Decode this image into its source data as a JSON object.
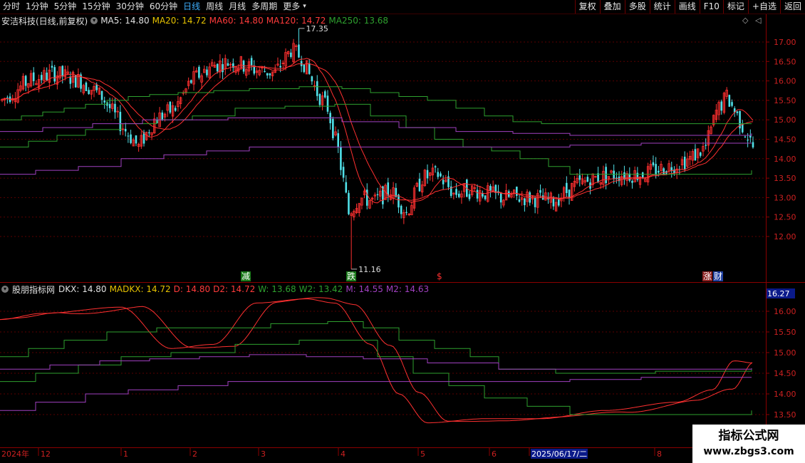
{
  "toolbar": {
    "left": [
      {
        "label": "分时",
        "active": false
      },
      {
        "label": "1分钟",
        "active": false
      },
      {
        "label": "5分钟",
        "active": false
      },
      {
        "label": "15分钟",
        "active": false
      },
      {
        "label": "30分钟",
        "active": false
      },
      {
        "label": "60分钟",
        "active": false
      },
      {
        "label": "日线",
        "active": true
      },
      {
        "label": "周线",
        "active": false
      },
      {
        "label": "月线",
        "active": false
      },
      {
        "label": "多周期",
        "active": false
      },
      {
        "label": "更多",
        "active": false
      }
    ],
    "more_arrow": "▾",
    "right": [
      "复权",
      "叠加",
      "多股",
      "统计",
      "画线",
      "F10",
      "标记",
      "+自选",
      "返回"
    ]
  },
  "main_info": {
    "stock": "安洁科技(日线,前复权)",
    "items": [
      {
        "text": "MA5: 14.80",
        "color": "#e0e0e0"
      },
      {
        "text": "MA20: 14.72",
        "color": "#e6c200"
      },
      {
        "text": "MA60: 14.80",
        "color": "#ff3b3b"
      },
      {
        "text": "MA120: 14.72",
        "color": "#ff3b3b"
      },
      {
        "text": "MA250: 13.68",
        "color": "#2ea02e"
      }
    ]
  },
  "sub_info": {
    "name": "股朋指标网",
    "items": [
      {
        "text": "DKX: 14.80",
        "color": "#e0e0e0"
      },
      {
        "text": "MADKX: 14.72",
        "color": "#e6c200"
      },
      {
        "text": "D: 14.80",
        "color": "#ff3b3b"
      },
      {
        "text": "D2: 14.72",
        "color": "#ff3b3b"
      },
      {
        "text": "W: 13.68",
        "color": "#2ea02e"
      },
      {
        "text": "W2: 13.42",
        "color": "#2ea02e"
      },
      {
        "text": "M: 14.55",
        "color": "#a040c0"
      },
      {
        "text": "M2: 14.63",
        "color": "#a040c0"
      }
    ]
  },
  "main_axis": [
    "17.00",
    "16.50",
    "16.00",
    "15.50",
    "15.00",
    "14.50",
    "14.00",
    "13.50",
    "13.00",
    "12.50",
    "12.00"
  ],
  "sub_axis": [
    "16.00",
    "15.50",
    "15.00",
    "14.50",
    "14.00",
    "13.50"
  ],
  "sub_axis_current": "16.27",
  "annotations": {
    "high": "17.35",
    "low": "11.16"
  },
  "markers": [
    {
      "text": "减",
      "bg": "#1a7a1a",
      "color": "#ffffff"
    },
    {
      "text": "跌",
      "bg": "#1a7a1a",
      "color": "#ffffff"
    },
    {
      "text": "$",
      "bg": "none",
      "color": "#ff3030"
    },
    {
      "text": "涨",
      "bg": "#8a2020",
      "color": "#ffffff"
    },
    {
      "text": "财",
      "bg": "#2040a0",
      "color": "#ffffff"
    }
  ],
  "time_axis": [
    "2024年",
    "12",
    "1",
    "2",
    "3",
    "4",
    "5",
    "6",
    "2025/06/17/二",
    "8"
  ],
  "watermark": {
    "line1": "指标公式网",
    "line2": "www.zbgs3.com"
  },
  "chart_data": {
    "type": "candlestick",
    "main_ylim": [
      11.0,
      17.6
    ],
    "sub_ylim": [
      13.2,
      16.5
    ],
    "high": 17.35,
    "low": 11.16
  }
}
